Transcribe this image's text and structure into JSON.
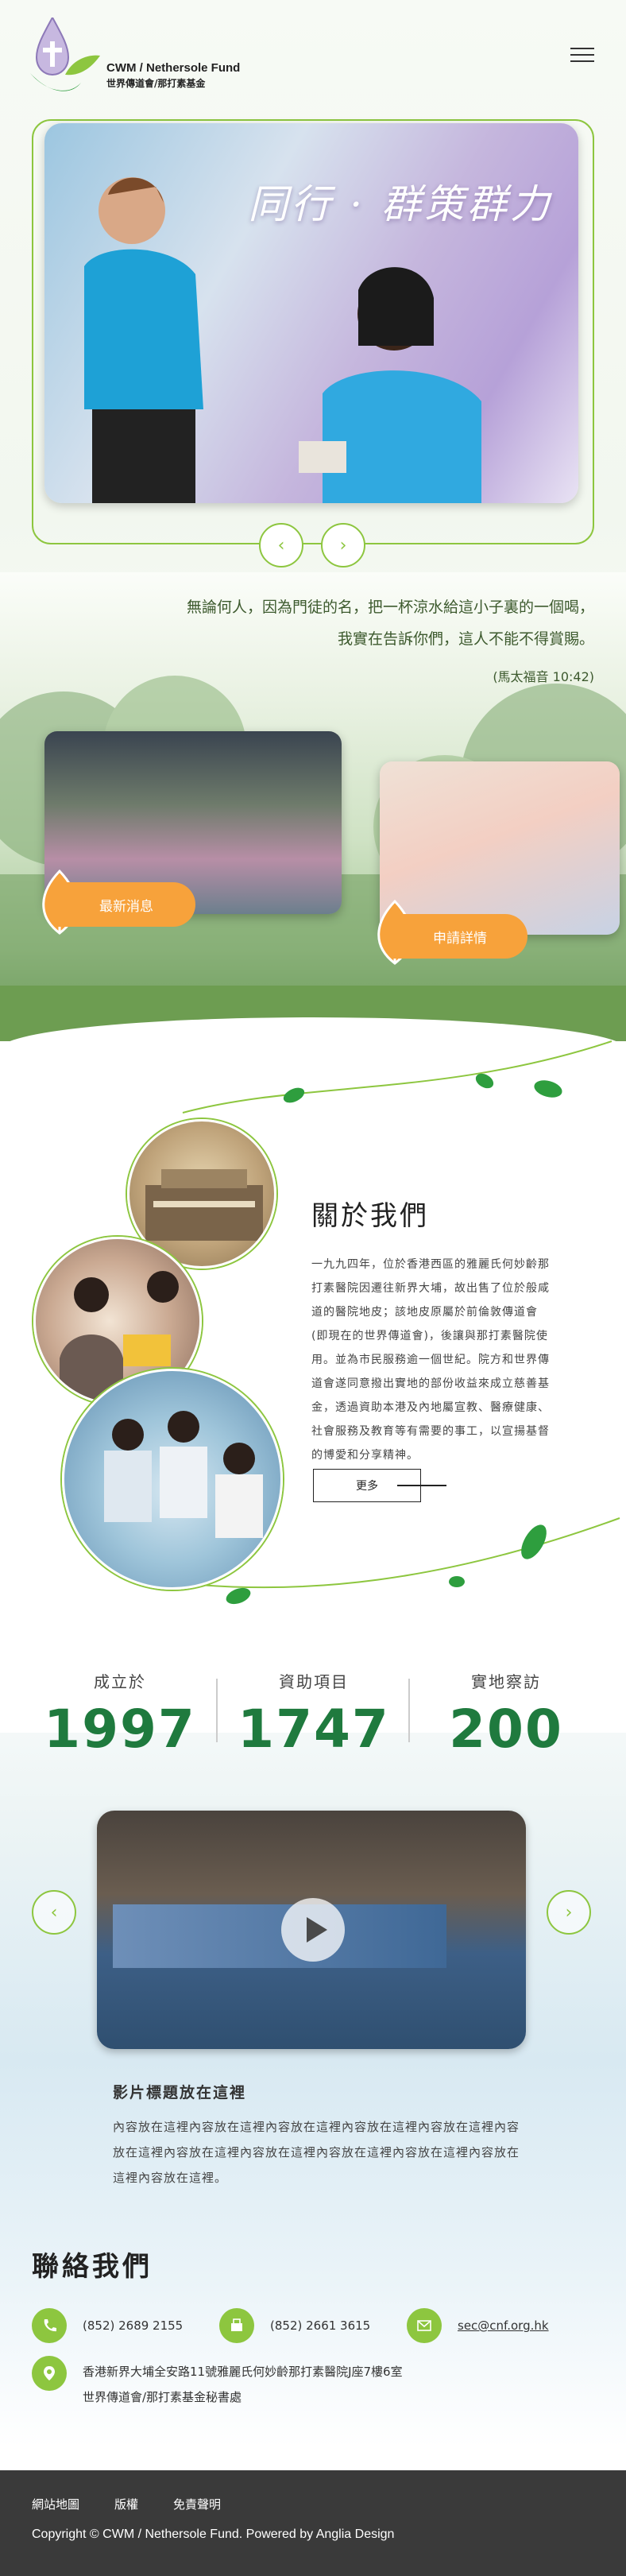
{
  "header": {
    "logo_en": "CWM / Nethersole Fund",
    "logo_zh": "世界傳道會/那打素基金",
    "menu_icon": "hamburger-menu-icon"
  },
  "hero": {
    "slogan": "同行 · 群策群力",
    "prev_icon": "chevron-left-icon",
    "next_icon": "chevron-right-icon"
  },
  "quote": {
    "line1": "無論何人，因為門徒的名，把一杯涼水給這小子裏的一個喝，",
    "line2": "我實在告訴你們，這人不能不得賞賜。",
    "ref": "(馬太福音 10:42)"
  },
  "cards": {
    "news_label": "最新消息",
    "apply_label": "申請詳情"
  },
  "about": {
    "title": "關於我們",
    "text": "一九九四年，位於香港西區的雅麗氏何妙齡那打素醫院因遷往新界大埔，故出售了位於般咸道的醫院地皮；該地皮原屬於前倫敦傳道會(即現在的世界傳道會)，後讓與那打素醫院使用。並為市民服務逾一個世紀。院方和世界傳道會遂同意撥出實地的部份收益來成立慈善基金，透過資助本港及內地屬宣教、醫療健康、社會服務及教育等有需要的事工，以宣揚基督的博愛和分享精神。",
    "more": "更多"
  },
  "stats": [
    {
      "label": "成立於",
      "value": "1997"
    },
    {
      "label": "資助項目",
      "value": "1747"
    },
    {
      "label": "實地察訪",
      "value": "200"
    }
  ],
  "video": {
    "title": "影片標題放在這裡",
    "text": "內容放在這裡內容放在這裡內容放在這裡內容放在這裡內容放在這裡內容放在這裡內容放在這裡內容放在這裡內容放在這裡內容放在這裡內容放在這裡內容放在這裡。"
  },
  "contact": {
    "title": "聯絡我們",
    "phone": "(852) 2689 2155",
    "fax": "(852) 2661 3615",
    "email": "sec@cnf.org.hk",
    "address_line1": "香港新界大埔全安路11號雅麗氏何妙齡那打素醫院J座7樓6室",
    "address_line2": "世界傳道會/那打素基金秘書處"
  },
  "footer": {
    "links": [
      "網站地圖",
      "版權",
      "免責聲明"
    ],
    "copyright": "Copyright © CWM / Nethersole Fund. Powered by Anglia Design"
  },
  "colors": {
    "accent_green": "#8dc63f",
    "dark_green": "#1f7a3e",
    "orange": "#f7a23b",
    "footer_bg": "#3a3a3a"
  }
}
